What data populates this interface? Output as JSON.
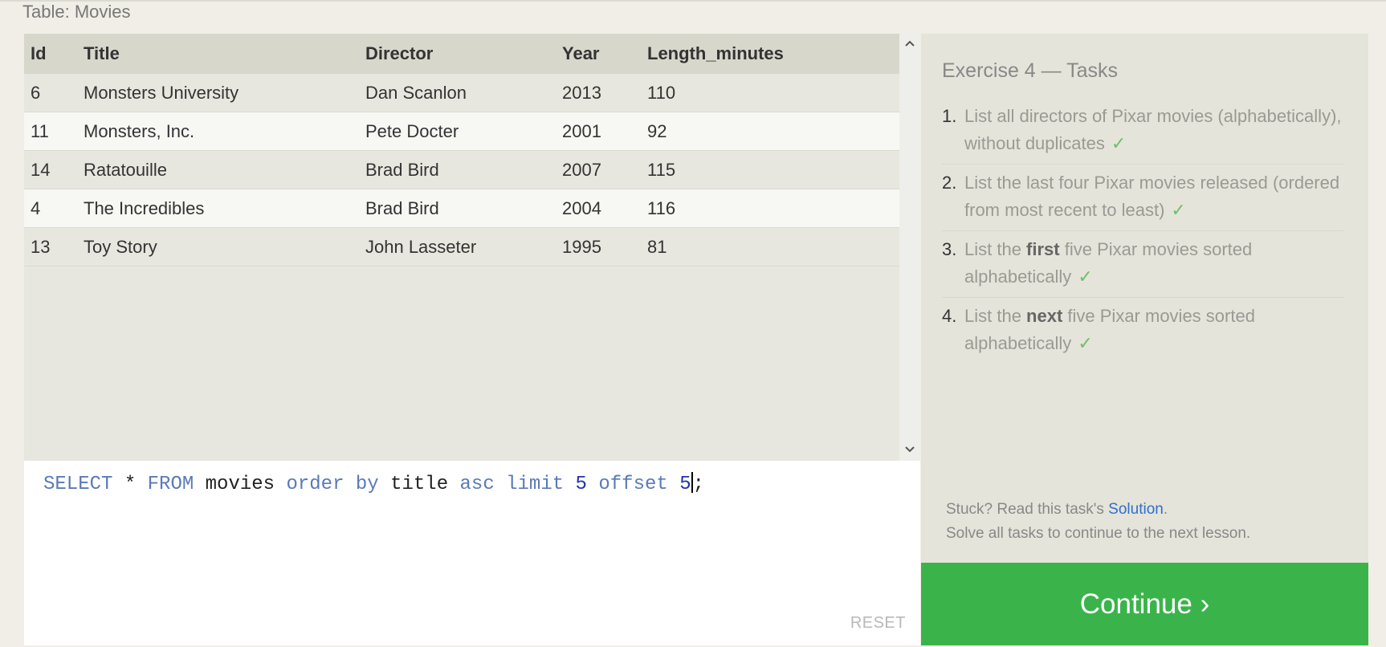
{
  "table_caption": "Table: Movies",
  "table": {
    "columns": [
      "Id",
      "Title",
      "Director",
      "Year",
      "Length_minutes"
    ],
    "rows": [
      [
        "6",
        "Monsters University",
        "Dan Scanlon",
        "2013",
        "110"
      ],
      [
        "11",
        "Monsters, Inc.",
        "Pete Docter",
        "2001",
        "92"
      ],
      [
        "14",
        "Ratatouille",
        "Brad Bird",
        "2007",
        "115"
      ],
      [
        "4",
        "The Incredibles",
        "Brad Bird",
        "2004",
        "116"
      ],
      [
        "13",
        "Toy Story",
        "John Lasseter",
        "1995",
        "81"
      ]
    ]
  },
  "scrollbar": {
    "up_icon": "chevron-up",
    "down_icon": "chevron-down"
  },
  "editor": {
    "tokens": [
      {
        "text": "SELECT",
        "type": "kw"
      },
      {
        "text": " * ",
        "type": "plain"
      },
      {
        "text": "FROM",
        "type": "kw"
      },
      {
        "text": " movies ",
        "type": "plain"
      },
      {
        "text": "order by",
        "type": "kw"
      },
      {
        "text": " title ",
        "type": "plain"
      },
      {
        "text": "asc limit",
        "type": "kw"
      },
      {
        "text": " ",
        "type": "plain"
      },
      {
        "text": "5",
        "type": "num"
      },
      {
        "text": " ",
        "type": "plain"
      },
      {
        "text": "offset",
        "type": "kw"
      },
      {
        "text": " ",
        "type": "plain"
      },
      {
        "text": "5",
        "type": "num"
      }
    ],
    "tail": ";",
    "reset_label": "RESET"
  },
  "tasks": {
    "title": "Exercise 4 — Tasks",
    "items": [
      {
        "num": "1.",
        "pre": "List all directors of Pixar movies (alphabetically), without duplicates",
        "bold": "",
        "post": "",
        "check": "✓"
      },
      {
        "num": "2.",
        "pre": "List the last four Pixar movies released (ordered from most recent to least)",
        "bold": "",
        "post": "",
        "check": "✓"
      },
      {
        "num": "3.",
        "pre": "List the ",
        "bold": "first",
        "post": " five Pixar movies sorted alphabetically",
        "check": "✓"
      },
      {
        "num": "4.",
        "pre": "List the ",
        "bold": "next",
        "post": " five Pixar movies sorted alphabetically",
        "check": "✓"
      }
    ],
    "stuck_prefix": "Stuck? Read this task's ",
    "solution_link": "Solution",
    "stuck_suffix": ".",
    "solve_all": "Solve all tasks to continue to the next lesson."
  },
  "continue_label": "Continue ›",
  "colors": {
    "continue": "#3ab44a",
    "check": "#6fbf6a",
    "keyword": "#5a7ab8",
    "link": "#2f6fca"
  }
}
